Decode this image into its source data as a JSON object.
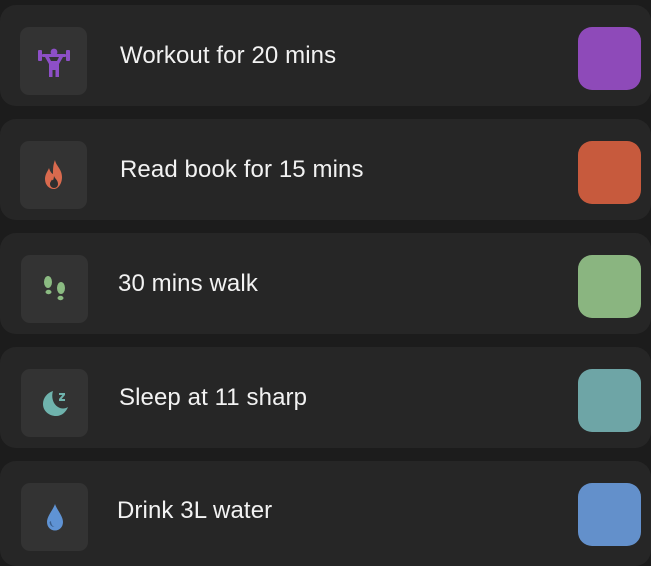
{
  "habits": [
    {
      "label": "Workout for 20 mins",
      "icon": "weightlifting-icon",
      "icon_color": "#8d4fc7",
      "swatch_color": "#8e4ab9"
    },
    {
      "label": "Read book for 15 mins",
      "icon": "fire-icon",
      "icon_color": "#d96a4e",
      "swatch_color": "#c75a3d"
    },
    {
      "label": "30 mins walk",
      "icon": "footprints-icon",
      "icon_color": "#8bbb82",
      "swatch_color": "#8ab580"
    },
    {
      "label": "Sleep at 11 sharp",
      "icon": "moon-sleep-icon",
      "icon_color": "#6fb3ad",
      "swatch_color": "#6ea5a6"
    },
    {
      "label": "Drink 3L water",
      "icon": "water-drop-icon",
      "icon_color": "#5f93d4",
      "swatch_color": "#6390cb"
    }
  ]
}
